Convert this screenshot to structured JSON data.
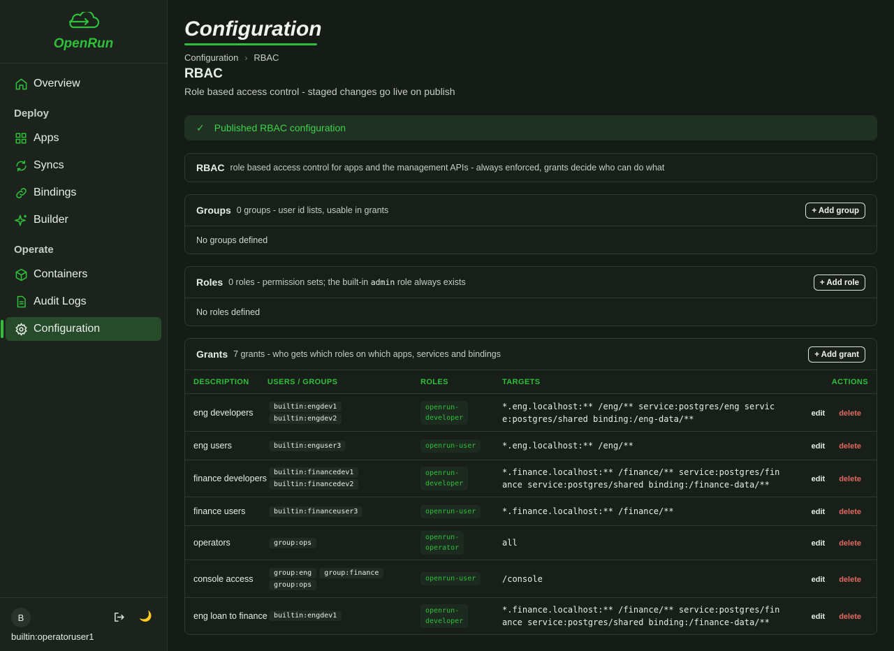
{
  "app": {
    "logo_text": "OpenRun"
  },
  "sidebar": {
    "overview": "Overview",
    "deploy_section": "Deploy",
    "apps": "Apps",
    "syncs": "Syncs",
    "bindings": "Bindings",
    "builder": "Builder",
    "operate_section": "Operate",
    "containers": "Containers",
    "audit_logs": "Audit Logs",
    "configuration": "Configuration",
    "avatar_initial": "B",
    "user": "builtin:operatoruser1"
  },
  "page": {
    "title": "Configuration",
    "breadcrumb": [
      "Configuration",
      "RBAC"
    ],
    "heading": "RBAC",
    "subtitle": "Role based access control - staged changes go live on publish"
  },
  "alert": {
    "text": "Published RBAC configuration"
  },
  "rbac_card": {
    "title": "RBAC",
    "desc": "role based access control for apps and the management APIs - always enforced, grants decide who can do what"
  },
  "groups_card": {
    "title": "Groups",
    "desc": "0 groups - user id lists, usable in grants",
    "button": "+ Add group",
    "empty": "No groups defined"
  },
  "roles_card": {
    "title": "Roles",
    "desc_before": "0 roles - permission sets; the built-in",
    "desc_code": "admin",
    "desc_after": "role always exists",
    "button": "+ Add role",
    "empty": "No roles defined"
  },
  "grants_card": {
    "title": "Grants",
    "desc": "7 grants - who gets which roles on which apps, services and bindings",
    "button": "+ Add grant",
    "columns": [
      "DESCRIPTION",
      "USERS / GROUPS",
      "ROLES",
      "TARGETS",
      "ACTIONS"
    ],
    "edit_label": "edit",
    "delete_label": "delete",
    "rows": [
      {
        "description": "eng developers",
        "users": [
          "builtin:engdev1",
          "builtin:engdev2"
        ],
        "role": "openrun-developer",
        "targets": "*.eng.localhost:** /eng/** service:postgres/eng service:postgres/shared binding:/eng-data/**"
      },
      {
        "description": "eng users",
        "users": [
          "builtin:enguser3"
        ],
        "role": "openrun-user",
        "targets": "*.eng.localhost:** /eng/**"
      },
      {
        "description": "finance developers",
        "users": [
          "builtin:financedev1",
          "builtin:financedev2"
        ],
        "role": "openrun-developer",
        "targets": "*.finance.localhost:** /finance/** service:postgres/finance service:postgres/shared binding:/finance-data/**"
      },
      {
        "description": "finance users",
        "users": [
          "builtin:financeuser3"
        ],
        "role": "openrun-user",
        "targets": "*.finance.localhost:** /finance/**"
      },
      {
        "description": "operators",
        "users": [
          "group:ops"
        ],
        "role": "openrun-operator",
        "targets": "all"
      },
      {
        "description": "console access",
        "users": [
          "group:eng",
          "group:finance",
          "group:ops"
        ],
        "role": "openrun-user",
        "targets": "/console"
      },
      {
        "description": "eng loan to finance",
        "users": [
          "builtin:engdev1"
        ],
        "role": "openrun-developer",
        "targets": "*.finance.localhost:** /finance/** service:postgres/finance service:postgres/shared binding:/finance-data/**"
      }
    ]
  },
  "colors": {
    "accent": "#2fbf3a",
    "danger": "#e06a60",
    "background": "#151b16",
    "sidebar": "#1b231c"
  },
  "icons": [
    "cloud-logo-icon",
    "home-icon",
    "grid-icon",
    "sync-icon",
    "link-icon",
    "sparkle-icon",
    "box-icon",
    "document-icon",
    "gear-icon",
    "logout-icon",
    "moon-icon",
    "check-icon"
  ]
}
